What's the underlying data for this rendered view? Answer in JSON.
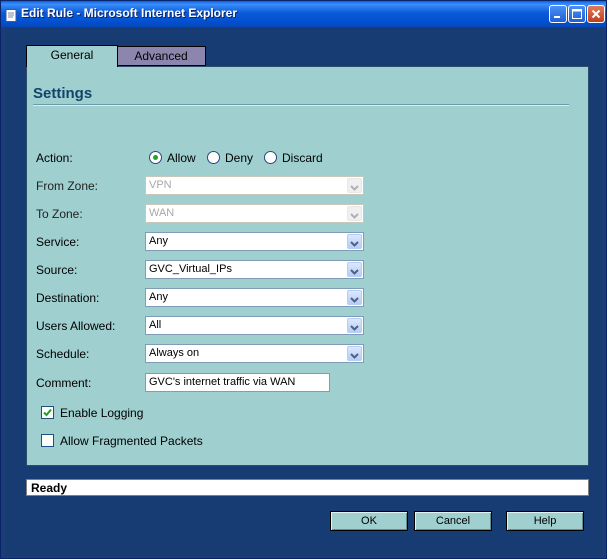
{
  "window": {
    "title": "Edit Rule - Microsoft Internet Explorer",
    "accent": "#0054e3"
  },
  "tabs": [
    {
      "label": "General",
      "active": true
    },
    {
      "label": "Advanced",
      "active": false
    }
  ],
  "settings": {
    "heading": "Settings",
    "action": {
      "label": "Action:",
      "options": [
        "Allow",
        "Deny",
        "Discard"
      ],
      "selected": "Allow"
    },
    "from_zone": {
      "label": "From Zone:",
      "value": "VPN",
      "disabled": true
    },
    "to_zone": {
      "label": "To Zone:",
      "value": "WAN",
      "disabled": true
    },
    "service": {
      "label": "Service:",
      "value": "Any"
    },
    "source": {
      "label": "Source:",
      "value": "GVC_Virtual_IPs"
    },
    "destination": {
      "label": "Destination:",
      "value": "Any"
    },
    "users_allowed": {
      "label": "Users Allowed:",
      "value": "All"
    },
    "schedule": {
      "label": "Schedule:",
      "value": "Always on"
    },
    "comment": {
      "label": "Comment:",
      "value": "GVC's internet traffic via WAN"
    },
    "enable_logging": {
      "label": "Enable Logging",
      "checked": true
    },
    "allow_fragmented": {
      "label": "Allow Fragmented Packets",
      "checked": false
    }
  },
  "status": {
    "text": "Ready"
  },
  "buttons": {
    "ok": "OK",
    "cancel": "Cancel",
    "help": "Help"
  },
  "icons": [
    "ie-page-icon",
    "minimize-icon",
    "maximize-icon",
    "close-icon",
    "chevron-down-icon",
    "checkmark-icon"
  ]
}
